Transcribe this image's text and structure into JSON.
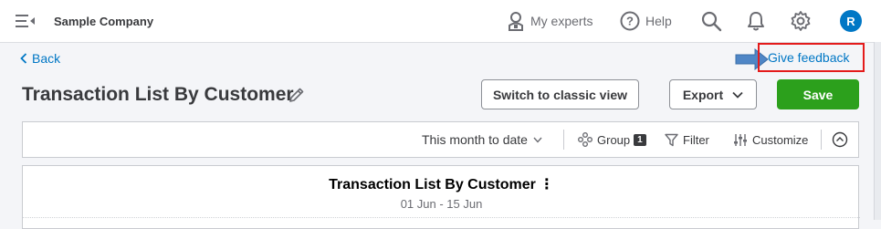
{
  "header": {
    "company_name": "Sample Company",
    "my_experts_label": "My experts",
    "help_label": "Help",
    "avatar_initial": "R"
  },
  "nav": {
    "back_label": "Back",
    "feedback_label": "Give feedback"
  },
  "page": {
    "title": "Transaction List By Customer",
    "switch_label": "Switch to classic view",
    "export_label": "Export",
    "save_label": "Save"
  },
  "toolbar": {
    "date_range": "This month to date",
    "group_label": "Group",
    "group_count": "1",
    "filter_label": "Filter",
    "customize_label": "Customize"
  },
  "report": {
    "title": "Transaction List By Customer",
    "period": "01 Jun - 15 Jun"
  },
  "colors": {
    "accent_blue": "#0077c5",
    "save_green": "#2ca01c",
    "highlight_red": "#e41b1b"
  }
}
